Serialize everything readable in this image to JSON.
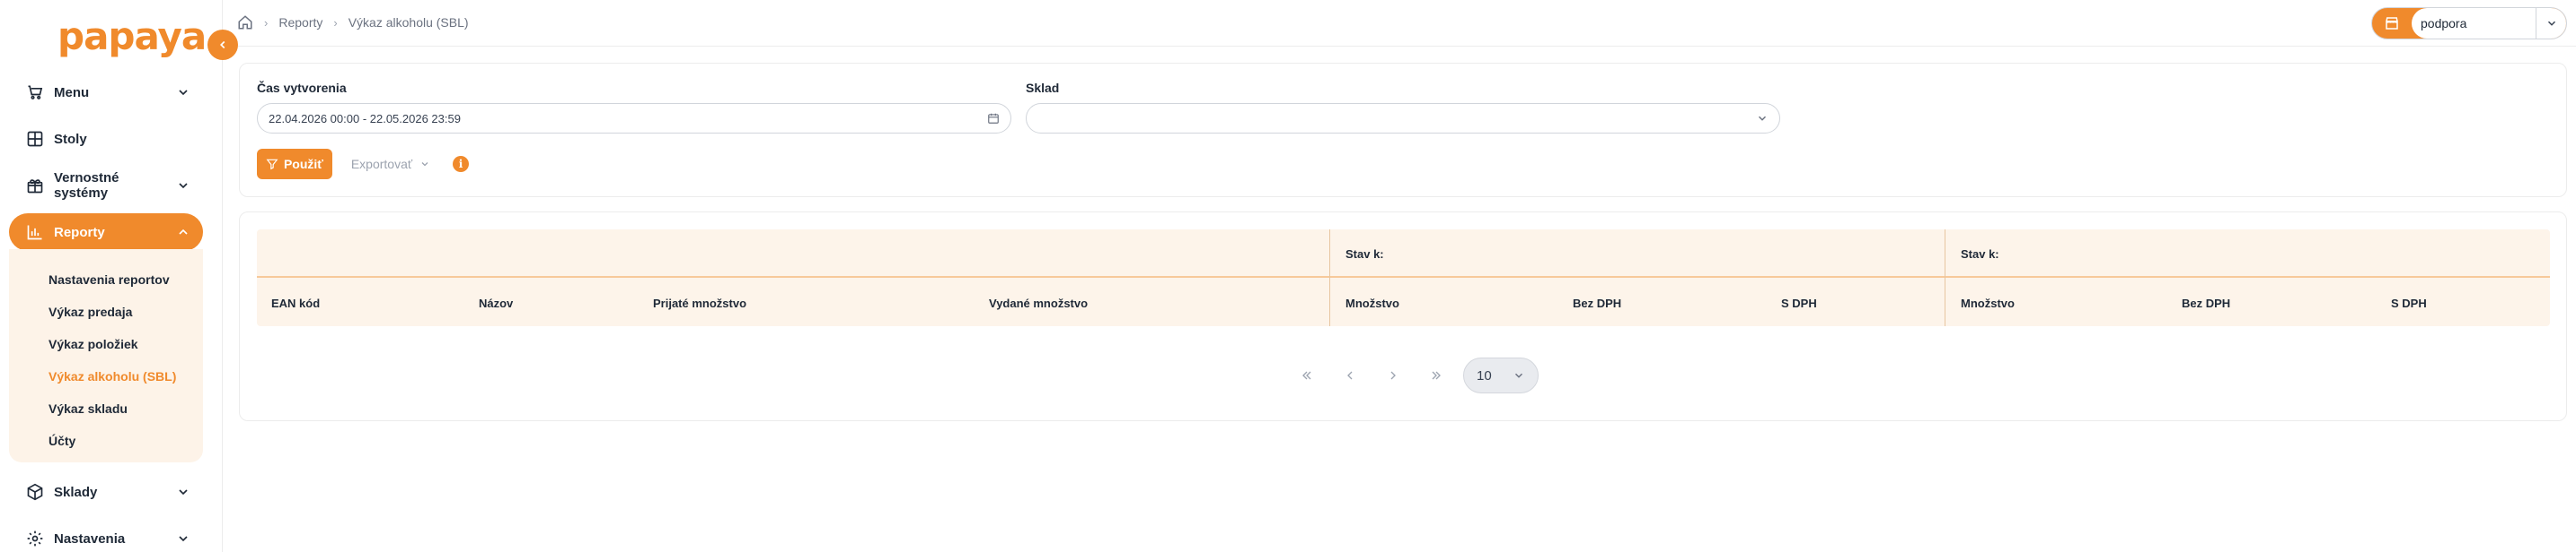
{
  "brand": {
    "logo_text": "papaya",
    "accent": "#f08a2c"
  },
  "sidebar": {
    "items": [
      {
        "label": "Menu",
        "icon": "cart-icon"
      },
      {
        "label": "Stoly",
        "icon": "table-grid-icon"
      },
      {
        "label": "Vernostné systémy",
        "icon": "gift-icon"
      },
      {
        "label": "Reporty",
        "icon": "bar-chart-icon"
      },
      {
        "label": "Sklady",
        "icon": "box-icon"
      },
      {
        "label": "Nastavenia",
        "icon": "gear-icon"
      }
    ],
    "reports_sub": [
      "Nastavenia reportov",
      "Výkaz predaja",
      "Výkaz položiek",
      "Výkaz alkoholu (SBL)",
      "Výkaz skladu",
      "Účty"
    ]
  },
  "breadcrumb": {
    "section": "Reporty",
    "page": "Výkaz alkoholu (SBL)"
  },
  "user": {
    "name": "podpora"
  },
  "filters": {
    "created_label": "Čas vytvorenia",
    "created_value": "22.04.2026 00:00 - 22.05.2026 23:59",
    "warehouse_label": "Sklad",
    "warehouse_value": "",
    "apply_label": "Použiť",
    "export_label": "Exportovať",
    "info_label": "i"
  },
  "table": {
    "group_label_1": "Stav k:",
    "group_label_2": "Stav k:",
    "columns": {
      "ean": "EAN kód",
      "name": "Názov",
      "received": "Prijaté množstvo",
      "issued": "Vydané množstvo",
      "qty1": "Množstvo",
      "net1": "Bez DPH",
      "gross1": "S DPH",
      "qty2": "Množstvo",
      "net2": "Bez DPH",
      "gross2": "S DPH"
    }
  },
  "pagination": {
    "page_size": "10"
  }
}
